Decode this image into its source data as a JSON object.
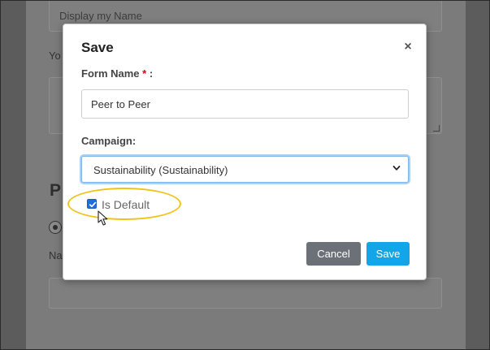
{
  "background": {
    "top_input_placeholder": "Display my Name",
    "label_partial_1": "Yo",
    "heading_partial": "P",
    "label_partial_2": "Na"
  },
  "modal": {
    "title": "Save",
    "close_glyph": "×",
    "form_name": {
      "label": "Form Name",
      "required_marker": "*",
      "label_suffix": " :",
      "value": "Peer to Peer"
    },
    "campaign": {
      "label": "Campaign:",
      "selected": "Sustainability (Sustainability)"
    },
    "is_default": {
      "label": "Is Default",
      "checked": true
    },
    "buttons": {
      "cancel": "Cancel",
      "save": "Save"
    }
  },
  "colors": {
    "save_button": "#12a5e8",
    "cancel_button": "#6b7177",
    "highlight_ring": "#f0c419",
    "checkbox": "#1f6fd8",
    "required": "#d0021b"
  }
}
